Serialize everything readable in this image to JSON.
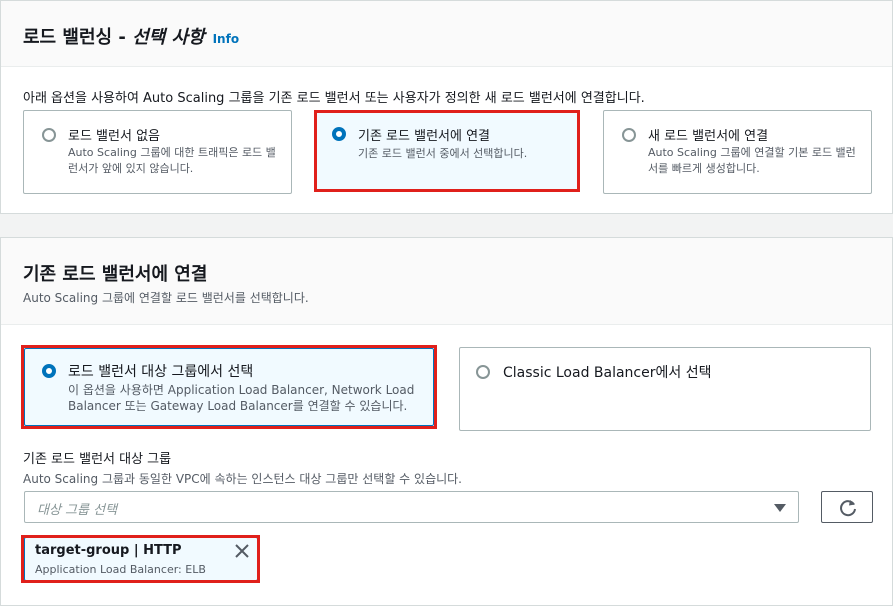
{
  "section1": {
    "title_plain": "로드 밸런싱 - ",
    "title_italic": "선택 사항",
    "info_label": "Info",
    "description": "아래 옵션을 사용하여 Auto Scaling 그룹을 기존 로드 밸런서 또는 사용자가 정의한 새 로드 밸런서에 연결합니다.",
    "options": [
      {
        "label": "로드 밸런서 없음",
        "desc": "Auto Scaling 그룹에 대한 트래픽은 로드 밸런서가 앞에 있지 않습니다.",
        "selected": false
      },
      {
        "label": "기존 로드 밸런서에 연결",
        "desc": "기존 로드 밸런서 중에서 선택합니다.",
        "selected": true
      },
      {
        "label": "새 로드 밸런서에 연결",
        "desc": "Auto Scaling 그룹에 연결할 기본 로드 밸런서를 빠르게 생성합니다.",
        "selected": false
      }
    ]
  },
  "section2": {
    "title": "기존 로드 밸런서에 연결",
    "subtitle": "Auto Scaling 그룹에 연결할 로드 밸런서를 선택합니다.",
    "options": [
      {
        "label": "로드 밸런서 대상 그룹에서 선택",
        "desc": "이 옵션을 사용하면 Application Load Balancer, Network Load Balancer 또는 Gateway Load Balancer를 연결할 수 있습니다.",
        "selected": true
      },
      {
        "label": "Classic Load Balancer에서 선택",
        "desc": "",
        "selected": false
      }
    ],
    "target_group": {
      "label": "기존 로드 밸런서 대상 그룹",
      "hint": "Auto Scaling 그룹과 동일한 VPC에 속하는 인스턴스 대상 그룹만 선택할 수 있습니다.",
      "placeholder": "대상 그룹 선택",
      "caret_icon": "caret-down-icon",
      "refresh_icon": "refresh-icon",
      "selected_token": {
        "name": "target-group | HTTP",
        "detail": "Application Load Balancer: ELB",
        "remove_icon": "close-icon"
      }
    }
  },
  "colors": {
    "accent": "#0073bb",
    "highlight": "#e0201b",
    "selected_bg": "#f1faff"
  }
}
